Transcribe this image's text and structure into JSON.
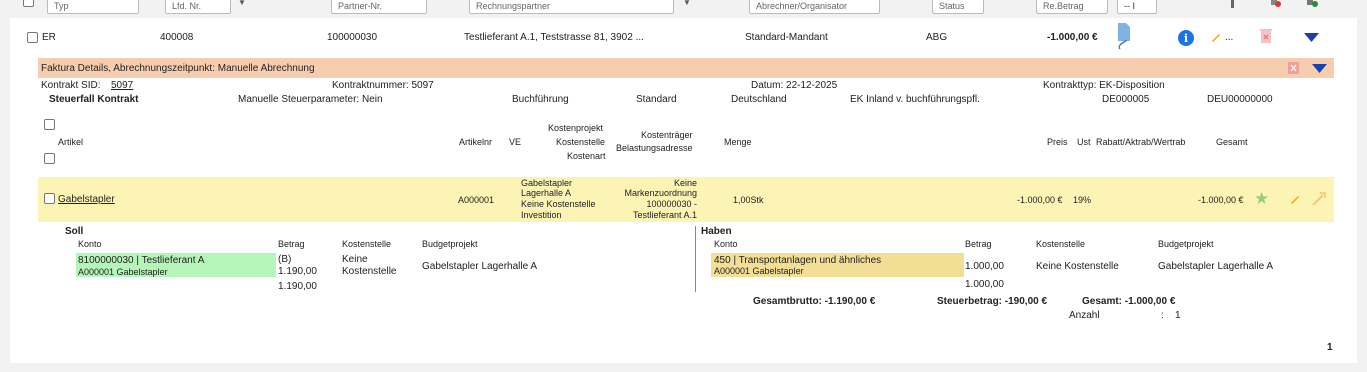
{
  "filters": {
    "typ": "Typ",
    "lfd_nr": "Lfd. Nr.",
    "partner_nr": "Partner-Nr.",
    "rechnungspartner": "Rechnungspartner",
    "abrechner": "Abrechner/Organisator",
    "status": "Status",
    "re_betrag": "Re.Betrag",
    "last_select": "-- I"
  },
  "main_row": {
    "typ": "ER",
    "lfd_nr": "400008",
    "partner_nr": "100000030",
    "rechnungspartner": "Testlieferant A.1, Teststrasse 81, 3902 ...",
    "mandant": "Standard-Mandant",
    "status": "ABG",
    "betrag": "-1.000,00 €",
    "more": "..."
  },
  "faktura": {
    "title": "Faktura Details, Abrechnungszeitpunkt: Manuelle Abrechnung",
    "kontrakt_sid_label": "Kontrakt SID:",
    "kontrakt_sid": "5097",
    "kontraktnummer": "Kontraktnummer: 5097",
    "datum": "Datum: 22-12-2025",
    "kontrakttyp": "Kontrakttyp: EK-Disposition",
    "steuerfall": "Steuerfall Kontrakt",
    "manuelle_steuer": "Manuelle Steuerparameter: Nein",
    "buchfuehrung": "Buchführung",
    "standard": "Standard",
    "land": "Deutschland",
    "ek_inland": "EK Inland v. buchführungspfl.",
    "code1": "DE000005",
    "code2": "DEU00000000"
  },
  "table_headers": {
    "artikel": "Artikel",
    "artikelnr": "Artikelnr",
    "ve": "VE",
    "kostenprojekt": "Kostenprojekt",
    "kostenstelle": "Kostenstelle",
    "kostenart": "Kostenart",
    "kostentraeger": "Kostenträger",
    "belastungsadresse": "Belastungsadresse",
    "menge": "Menge",
    "preis": "Preis",
    "ust": "Ust",
    "rabatt": "Rabatt/Aktrab/Wertrab",
    "gesamt": "Gesamt"
  },
  "item": {
    "artikel": "Gabelstapler",
    "artikelnr": "A000001",
    "kosten_line1": "Gabelstapler",
    "kosten_line2": "Lagerhalle A",
    "kosten_line3": "Keine Kostenstelle",
    "kosten_line4": "Investition",
    "traeger_line1": "Keine",
    "traeger_line2": "Markenzuordnung",
    "traeger_line3": "100000030 -",
    "traeger_line4": "Testlieferant A.1",
    "menge": "1,00Stk",
    "preis": "-1.000,00 €",
    "ust": "19%",
    "gesamt": "-1.000,00 €"
  },
  "soll": {
    "title": "Soll",
    "konto_hdr": "Konto",
    "betrag_hdr": "Betrag",
    "kostenstelle_hdr": "Kostenstelle",
    "budget_hdr": "Budgetprojekt",
    "konto": "8100000030 | Testlieferant A",
    "konto_sub": "A000001 Gabelstapler",
    "betrag_flag": "(B)",
    "betrag1": "1.190,00",
    "betrag2": "1.190,00",
    "kostenstelle_l1": "Keine",
    "kostenstelle_l2": "Kostenstelle",
    "budget": "Gabelstapler Lagerhalle A"
  },
  "haben": {
    "title": "Haben",
    "konto_hdr": "Konto",
    "betrag_hdr": "Betrag",
    "kostenstelle_hdr": "Kostenstelle",
    "budget_hdr": "Budgetprojekt",
    "konto": "450 | Transportanlagen und ähnliches",
    "konto_sub": "A000001 Gabelstapler",
    "betrag1": "1.000,00",
    "betrag2": "1.000,00",
    "kostenstelle": "Keine Kostenstelle",
    "budget": "Gabelstapler Lagerhalle A"
  },
  "totals": {
    "gesamtbrutto": "Gesamtbrutto: -1.190,00 €",
    "steuerbetrag": "Steuerbetrag: -190,00 €",
    "gesamt": "Gesamt: -1.000,00 €",
    "anzahl_label": "Anzahl",
    "anzahl_sep": ":",
    "anzahl": "1"
  },
  "pagination": {
    "page": "1"
  },
  "colors": {
    "orange": "#f7cdb0",
    "yellow": "#fcf4b4",
    "green": "#b6f5b9",
    "tan": "#f3de96",
    "accent": "#1e3fae"
  }
}
